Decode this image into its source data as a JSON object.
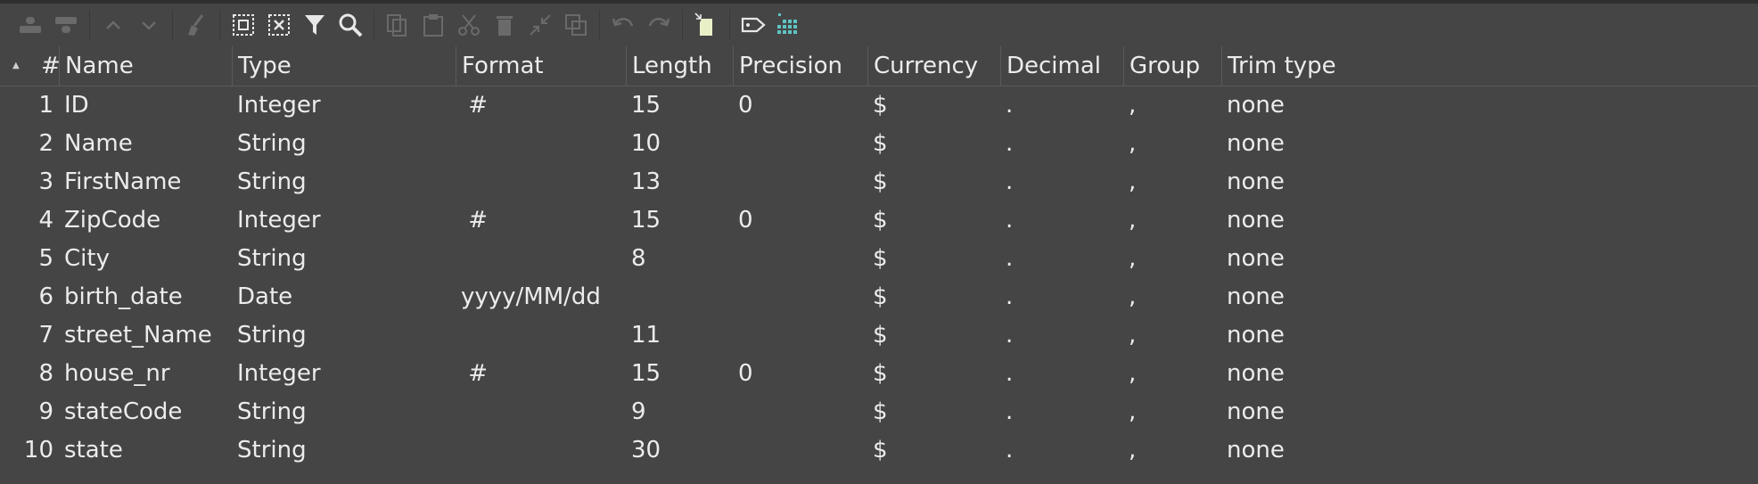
{
  "toolbar": {
    "buttons": [
      {
        "name": "insert-row-before-icon",
        "enabled": false
      },
      {
        "name": "insert-row-after-icon",
        "enabled": false
      },
      {
        "name": "move-up-icon",
        "enabled": false
      },
      {
        "name": "move-down-icon",
        "enabled": false
      },
      {
        "name": "clean-icon",
        "enabled": false
      },
      {
        "name": "select-all-icon",
        "enabled": true
      },
      {
        "name": "clear-selection-icon",
        "enabled": true
      },
      {
        "name": "filter-icon",
        "enabled": true
      },
      {
        "name": "search-icon",
        "enabled": true
      },
      {
        "name": "copy-icon",
        "enabled": false
      },
      {
        "name": "paste-icon",
        "enabled": false
      },
      {
        "name": "cut-icon",
        "enabled": false
      },
      {
        "name": "delete-icon",
        "enabled": false
      },
      {
        "name": "collapse-icon",
        "enabled": false
      },
      {
        "name": "duplicate-icon",
        "enabled": false
      },
      {
        "name": "undo-icon",
        "enabled": false
      },
      {
        "name": "redo-icon",
        "enabled": false
      },
      {
        "name": "get-fields-icon",
        "enabled": true
      },
      {
        "name": "tag-icon",
        "enabled": true
      },
      {
        "name": "grid-icon",
        "enabled": true
      }
    ]
  },
  "table": {
    "headers": {
      "num": "#",
      "name": "Name",
      "type": "Type",
      "format": "Format",
      "length": "Length",
      "precision": "Precision",
      "currency": "Currency",
      "decimal": "Decimal",
      "group": "Group",
      "trim": "Trim type"
    },
    "rows": [
      {
        "num": "1",
        "name": "ID",
        "type": "Integer",
        "format": " #",
        "length": "15",
        "precision": "0",
        "currency": "$",
        "decimal": ".",
        "group": ",",
        "trim": "none"
      },
      {
        "num": "2",
        "name": "Name",
        "type": "String",
        "format": "",
        "length": "10",
        "precision": "",
        "currency": "$",
        "decimal": ".",
        "group": ",",
        "trim": "none"
      },
      {
        "num": "3",
        "name": "FirstName",
        "type": "String",
        "format": "",
        "length": "13",
        "precision": "",
        "currency": "$",
        "decimal": ".",
        "group": ",",
        "trim": "none"
      },
      {
        "num": "4",
        "name": "ZipCode",
        "type": "Integer",
        "format": " #",
        "length": "15",
        "precision": "0",
        "currency": "$",
        "decimal": ".",
        "group": ",",
        "trim": "none"
      },
      {
        "num": "5",
        "name": "City",
        "type": "String",
        "format": "",
        "length": "8",
        "precision": "",
        "currency": "$",
        "decimal": ".",
        "group": ",",
        "trim": "none"
      },
      {
        "num": "6",
        "name": "birth_date",
        "type": "Date",
        "format": "yyyy/MM/dd",
        "length": "",
        "precision": "",
        "currency": "$",
        "decimal": ".",
        "group": ",",
        "trim": "none"
      },
      {
        "num": "7",
        "name": "street_Name",
        "type": "String",
        "format": "",
        "length": "11",
        "precision": "",
        "currency": "$",
        "decimal": ".",
        "group": ",",
        "trim": "none"
      },
      {
        "num": "8",
        "name": "house_nr",
        "type": "Integer",
        "format": " #",
        "length": "15",
        "precision": "0",
        "currency": "$",
        "decimal": ".",
        "group": ",",
        "trim": "none"
      },
      {
        "num": "9",
        "name": "stateCode",
        "type": "String",
        "format": "",
        "length": "9",
        "precision": "",
        "currency": "$",
        "decimal": ".",
        "group": ",",
        "trim": "none"
      },
      {
        "num": "10",
        "name": "state",
        "type": "String",
        "format": "",
        "length": "30",
        "precision": "",
        "currency": "$",
        "decimal": ".",
        "group": ",",
        "trim": "none"
      }
    ]
  }
}
